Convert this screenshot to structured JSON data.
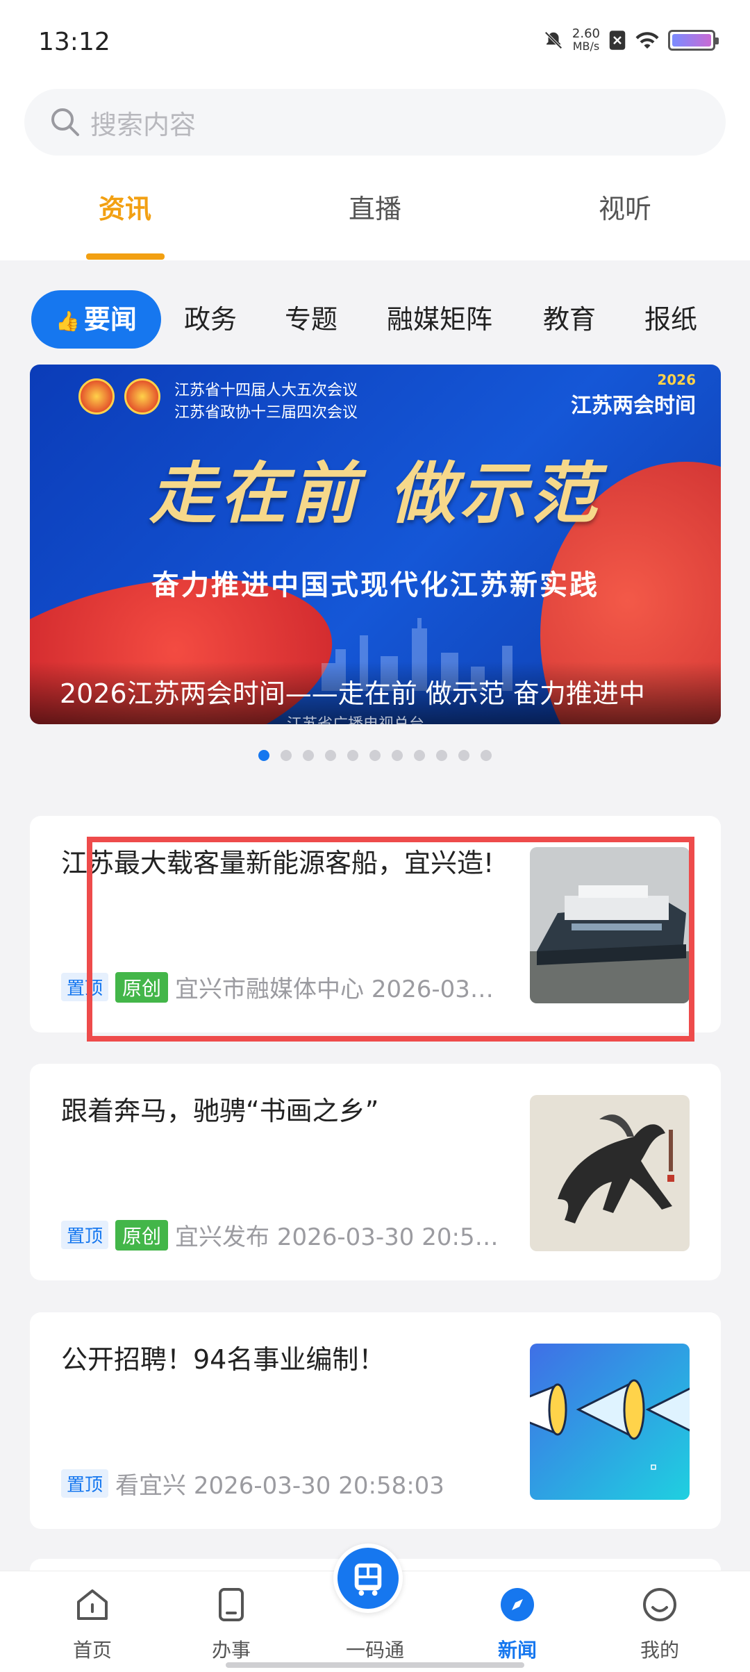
{
  "status_bar": {
    "time": "13:12",
    "net_speed": "2.60",
    "net_unit": "MB/s"
  },
  "search": {
    "placeholder": "搜索内容"
  },
  "main_tabs": [
    "资讯",
    "直播",
    "视听"
  ],
  "sub_tabs": [
    "要闻",
    "政务",
    "专题",
    "融媒矩阵",
    "教育",
    "报纸"
  ],
  "banner": {
    "meeting_lines": [
      "江苏省十四届人大五次会议",
      "江苏省政协十三届四次会议"
    ],
    "brand_year": "2026",
    "brand": "江苏两会时间",
    "slogan": "走在前 做示范",
    "subslogan": "奋力推进中国式现代化江苏新实践",
    "caption": "2026江苏两会时间——走在前 做示范 奋力推进中",
    "credit": "江苏省广播电视总台",
    "dot_count": 11,
    "active_dot": 0
  },
  "news": [
    {
      "title": "江苏最大载客量新能源客船，宜兴造!",
      "badges": [
        "置顶",
        "原创"
      ],
      "source": "宜兴市融媒体中心 2026-03…",
      "thumb": "ship-photo"
    },
    {
      "title": "跟着奔马，驰骋“书画之乡”",
      "badges": [
        "置顶",
        "原创"
      ],
      "source": "宜兴发布 2026-03-30 20:5…",
      "thumb": "horse-painting"
    },
    {
      "title": "公开招聘！94名事业编制！",
      "badges": [
        "置顶"
      ],
      "source": "看宜兴 2026-03-30 20:58:03",
      "thumb": "megaphone-graphic"
    }
  ],
  "bottom_nav": [
    "首页",
    "办事",
    "一码通",
    "新闻",
    "我的"
  ],
  "colors": {
    "accent": "#1677ef",
    "tab_active": "#f2a012",
    "original_badge": "#43b649",
    "highlight": "#ee4b4b"
  }
}
